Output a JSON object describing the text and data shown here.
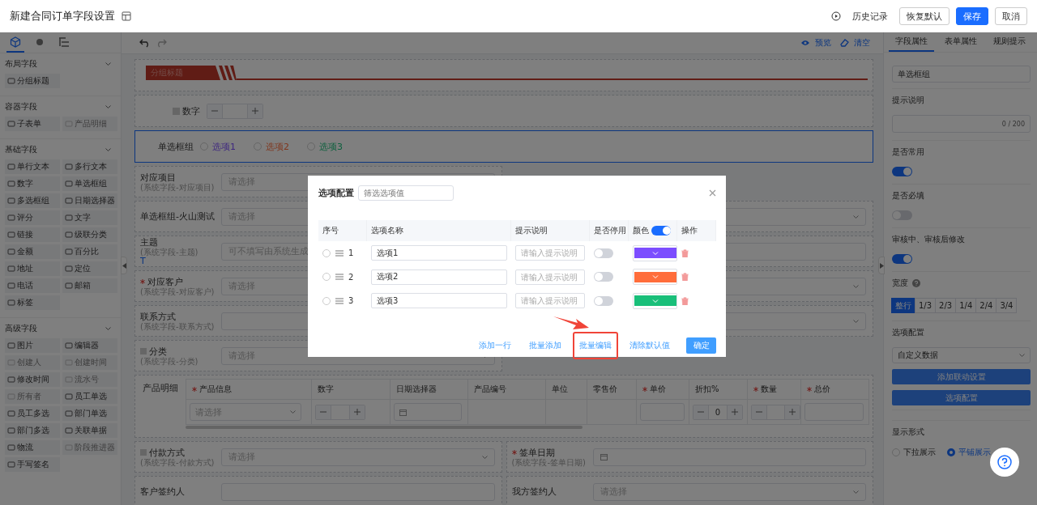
{
  "header": {
    "title": "新建合同订单字段设置",
    "history": "历史记录",
    "buttons": [
      {
        "label": "恢复默认",
        "kind": "default"
      },
      {
        "label": "保存",
        "kind": "primary"
      },
      {
        "label": "取消",
        "kind": "default"
      }
    ]
  },
  "sidebar": {
    "tabs": [
      {
        "selected": true
      },
      {
        "selected": false
      },
      {
        "selected": false
      }
    ],
    "sections": [
      {
        "title": "布局字段",
        "expanded": true,
        "items": [
          {
            "label": "分组标题",
            "disabled": false
          }
        ]
      },
      {
        "title": "容器字段",
        "expanded": true,
        "items": [
          {
            "label": "子表单",
            "disabled": false
          },
          {
            "label": "产品明细",
            "disabled": true
          }
        ]
      },
      {
        "title": "基础字段",
        "expanded": true,
        "items": [
          {
            "label": "单行文本",
            "disabled": false
          },
          {
            "label": "多行文本",
            "disabled": false
          },
          {
            "label": "数字",
            "disabled": false
          },
          {
            "label": "单选框组",
            "disabled": false
          },
          {
            "label": "多选框组",
            "disabled": false
          },
          {
            "label": "日期选择器",
            "disabled": false
          },
          {
            "label": "评分",
            "disabled": false
          },
          {
            "label": "文字",
            "disabled": false
          },
          {
            "label": "链接",
            "disabled": false
          },
          {
            "label": "级联分类",
            "disabled": false
          },
          {
            "label": "金额",
            "disabled": false
          },
          {
            "label": "百分比",
            "disabled": false
          },
          {
            "label": "地址",
            "disabled": false
          },
          {
            "label": "定位",
            "disabled": false
          },
          {
            "label": "电话",
            "disabled": false
          },
          {
            "label": "邮箱",
            "disabled": false
          },
          {
            "label": "标签",
            "disabled": false
          }
        ]
      },
      {
        "title": "高级字段",
        "expanded": true,
        "items": [
          {
            "label": "图片",
            "disabled": false
          },
          {
            "label": "编辑器",
            "disabled": false
          },
          {
            "label": "创建人",
            "disabled": true
          },
          {
            "label": "创建时间",
            "disabled": true
          },
          {
            "label": "修改时间",
            "disabled": false
          },
          {
            "label": "流水号",
            "disabled": true
          },
          {
            "label": "所有者",
            "disabled": true
          },
          {
            "label": "员工单选",
            "disabled": false
          },
          {
            "label": "员工多选",
            "disabled": false
          },
          {
            "label": "部门单选",
            "disabled": false
          },
          {
            "label": "部门多选",
            "disabled": false
          },
          {
            "label": "关联单据",
            "disabled": false
          },
          {
            "label": "物流",
            "disabled": false
          },
          {
            "label": "阶段推进器",
            "disabled": true
          },
          {
            "label": "手写签名",
            "disabled": false
          }
        ]
      }
    ]
  },
  "canvas": {
    "toolbar": {
      "preview": "预览",
      "clear": "清空"
    },
    "banner": {
      "title": "分组标题"
    },
    "number_field": {
      "label": "数字"
    },
    "radio_group": {
      "label": "单选框组",
      "selected": true,
      "options": [
        {
          "label": "选项1"
        },
        {
          "label": "选项2"
        },
        {
          "label": "选项3"
        }
      ]
    },
    "rows": [
      {
        "left": {
          "label": "对应项目",
          "note": "(系统字段-对应项目)",
          "kind": "select",
          "placeholder": "请选择",
          "required": false,
          "marked": false
        }
      },
      {
        "left": {
          "label": "单选框组-火山测试",
          "kind": "select",
          "placeholder": "请选择",
          "required": false,
          "marked": false
        },
        "right": {
          "kind": "select"
        }
      },
      {
        "left": {
          "label": "主题",
          "note": "(系统字段-主题)",
          "type_mark": "T",
          "kind": "input",
          "placeholder": "可不填写由系统生成",
          "required": false,
          "marked": false
        },
        "right": {
          "kind": "input"
        }
      },
      {
        "left": {
          "label": "对应客户",
          "note": "(系统字段-对应客户)",
          "kind": "select",
          "placeholder": "请选择",
          "required": true,
          "marked": false
        },
        "right": {
          "kind": "select"
        }
      },
      {
        "left": {
          "label": "联系方式",
          "note": "(系统字段-联系方式)",
          "kind": "input",
          "required": false,
          "marked": false
        },
        "right": {
          "kind": "select"
        }
      },
      {
        "left": {
          "label": "分类",
          "note": "(系统字段-分类)",
          "kind": "select",
          "placeholder": "请选择",
          "required": false,
          "marked": true
        }
      }
    ],
    "product_table": {
      "label": "产品明细",
      "columns": [
        {
          "title": "产品信息",
          "required": true,
          "kind": "select",
          "placeholder": "请选择"
        },
        {
          "title": "数字",
          "required": false,
          "kind": "stepper"
        },
        {
          "title": "日期选择器",
          "required": false,
          "kind": "date"
        },
        {
          "title": "产品编号",
          "required": false,
          "kind": "none"
        },
        {
          "title": "单位",
          "required": false,
          "kind": "none"
        },
        {
          "title": "零售价",
          "required": false,
          "kind": "none"
        },
        {
          "title": "单价",
          "required": true,
          "kind": "input"
        },
        {
          "title": "折扣%",
          "required": false,
          "kind": "stepper",
          "value": "0"
        },
        {
          "title": "数量",
          "required": true,
          "kind": "stepper"
        },
        {
          "title": "总价",
          "required": true,
          "kind": "input"
        }
      ]
    },
    "bottom_rows": [
      {
        "left": {
          "label": "付款方式",
          "note": "(系统字段-付款方式)",
          "kind": "select",
          "placeholder": "请选择",
          "required": false,
          "marked": true
        },
        "right": {
          "label": "签单日期",
          "note": "(系统字段-签单日期)",
          "kind": "date",
          "required": true,
          "marked": false
        }
      },
      {
        "left": {
          "label": "客户签约人",
          "kind": "input",
          "required": false,
          "marked": false
        },
        "right": {
          "label": "我方签约人",
          "kind": "select",
          "placeholder": "请选择",
          "required": false,
          "marked": false
        }
      }
    ]
  },
  "properties": {
    "tabs": [
      {
        "label": "字段属性",
        "selected": true
      },
      {
        "label": "表单属性",
        "selected": false
      },
      {
        "label": "规则提示",
        "selected": false
      }
    ],
    "name_value": "单选框组",
    "hint_label": "提示说明",
    "hint_counter": "0 / 200",
    "switches": [
      {
        "label": "是否常用",
        "on": true
      },
      {
        "label": "是否必填",
        "on": false
      },
      {
        "label": "审核中、审核后修改",
        "on": true
      }
    ],
    "width_label": "宽度",
    "widths": [
      {
        "label": "整行",
        "selected": true
      },
      {
        "label": "1/3",
        "selected": false
      },
      {
        "label": "2/3",
        "selected": false
      },
      {
        "label": "1/4",
        "selected": false
      },
      {
        "label": "2/4",
        "selected": false
      },
      {
        "label": "3/4",
        "selected": false
      }
    ],
    "options_label": "选项配置",
    "options_source": "自定义数据",
    "buttons": [
      "添加联动设置",
      "选项配置"
    ],
    "display_label": "显示形式",
    "display_modes": [
      {
        "label": "下拉展示",
        "selected": false
      },
      {
        "label": "平铺展示",
        "selected": true
      }
    ]
  },
  "modal": {
    "title": "选项配置",
    "search_placeholder": "筛选选项值",
    "columns": [
      "序号",
      "选项名称",
      "提示说明",
      "是否停用",
      "颜色",
      "操作"
    ],
    "color_enabled": true,
    "options": [
      {
        "index": "1",
        "name": "选项1",
        "hint_placeholder": "请输入提示说明",
        "disabled": false,
        "selected": false,
        "color": "#7c4dff"
      },
      {
        "index": "2",
        "name": "选项2",
        "hint_placeholder": "请输入提示说明",
        "disabled": false,
        "selected": false,
        "color": "#ff6d3b"
      },
      {
        "index": "3",
        "name": "选项3",
        "hint_placeholder": "请输入提示说明",
        "disabled": false,
        "selected": false,
        "color": "#19bf7a"
      }
    ],
    "actions": [
      {
        "label": "添加一行",
        "highlighted": false
      },
      {
        "label": "批量添加",
        "highlighted": false
      },
      {
        "label": "批量编辑",
        "highlighted": true
      },
      {
        "label": "清除默认值",
        "highlighted": false
      }
    ],
    "confirm": "确定"
  }
}
